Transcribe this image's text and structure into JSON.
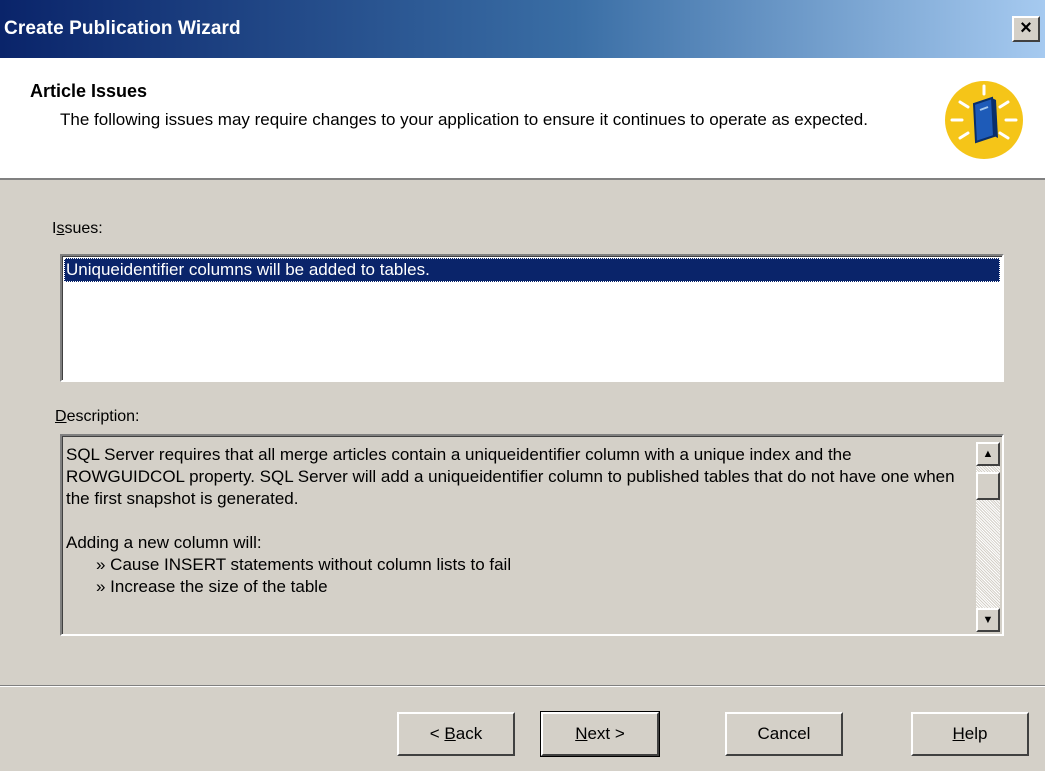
{
  "window": {
    "title": "Create Publication Wizard",
    "close_label": "×"
  },
  "header": {
    "title": "Article Issues",
    "description": "The following issues may require changes to your application to ensure it continues to operate as expected."
  },
  "issues": {
    "label_mnemonic": "I",
    "label_underlined": "s",
    "label_rest": "sues:",
    "items": [
      "Uniqueidentifier columns will be added to tables."
    ],
    "selected_index": 0
  },
  "description": {
    "label_underlined": "D",
    "label_rest": "escription:",
    "paragraph": "SQL Server requires that all merge articles contain a uniqueidentifier column with a unique index and the ROWGUIDCOL property. SQL Server will add a uniqueidentifier column to published tables that do not have one when the first snapshot is generated.",
    "lead": "Adding a new column will:",
    "bullets": [
      "» Cause INSERT statements without column lists to fail",
      "» Increase the size of the table"
    ]
  },
  "scrollbar": {
    "up_glyph": "▲",
    "down_glyph": "▼"
  },
  "buttons": {
    "back_prefix": "< ",
    "back_underlined": "B",
    "back_rest": "ack",
    "next_underlined": "N",
    "next_rest": "ext >",
    "cancel": "Cancel",
    "help_underlined": "H",
    "help_rest": "elp"
  },
  "colors": {
    "titlebar_start": "#0a246a",
    "titlebar_end": "#a6caf0",
    "selection": "#0a246a",
    "dialog_face": "#d4d0c8",
    "icon_sun": "#f5c518"
  },
  "icons": {
    "wizard": "book-sun-icon"
  }
}
